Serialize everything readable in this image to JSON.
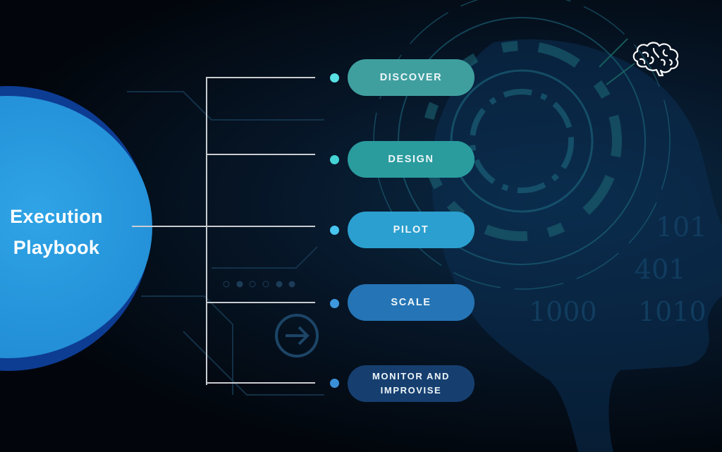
{
  "diagram": {
    "title_line1": "Execution",
    "title_line2": "Playbook",
    "steps": [
      {
        "label": "DISCOVER",
        "color": "#3f9f9f",
        "dot_color": "#58e0e4"
      },
      {
        "label": "DESIGN",
        "color": "#2a9c9e",
        "dot_color": "#45d3d6"
      },
      {
        "label": "PILOT",
        "color": "#2b9fcf",
        "dot_color": "#48c4f0"
      },
      {
        "label": "SCALE",
        "color": "#2574b5",
        "dot_color": "#3d98e0"
      },
      {
        "label_line1": "MONITOR AND",
        "label_line2": "IMPROVISE",
        "color": "#163f70",
        "dot_color": "#3a8fd8"
      }
    ],
    "connector_color": "#c9ccd0",
    "circle_color": "#2491d8",
    "circle_ring_color": "#0d3c93"
  },
  "decor": {
    "icon": "brain-icon",
    "background_binary": [
      "101",
      "401",
      "1000",
      "1010"
    ]
  }
}
